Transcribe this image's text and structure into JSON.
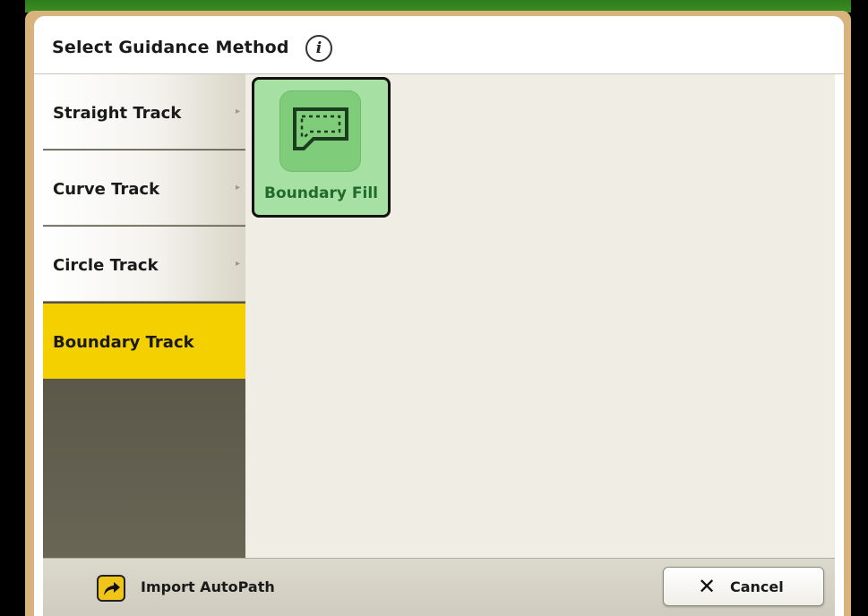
{
  "dialog": {
    "title": "Select Guidance Method",
    "info_icon": "info-icon",
    "info_glyph": "i"
  },
  "sidebar": {
    "items": [
      {
        "label": "Straight Track",
        "chevron": "▸",
        "selected": false
      },
      {
        "label": "Curve Track",
        "chevron": "▸",
        "selected": false
      },
      {
        "label": "Circle Track",
        "chevron": "▸",
        "selected": false
      },
      {
        "label": "Boundary Track",
        "selected": true
      }
    ]
  },
  "content": {
    "tiles": [
      {
        "label": "Boundary Fill",
        "icon": "boundary-fill-icon",
        "selected": true
      }
    ]
  },
  "footer": {
    "import_label": "Import AutoPath",
    "import_icon": "import-arrow-icon",
    "cancel_label": "Cancel",
    "cancel_icon": "close-icon",
    "cancel_glyph": "✕"
  },
  "colors": {
    "selected_yellow": "#f5d000",
    "tile_green": "#a6e0a2",
    "tile_text_green": "#1f6a2c",
    "frame_tan": "#d9b37c"
  }
}
